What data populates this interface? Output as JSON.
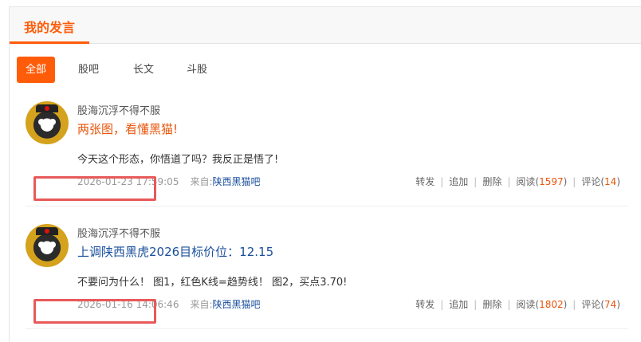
{
  "header": {
    "title": "我的发言"
  },
  "tabs": [
    {
      "label": "全部",
      "active": true
    },
    {
      "label": "股吧"
    },
    {
      "label": "长文"
    },
    {
      "label": "斗股"
    }
  ],
  "posts": [
    {
      "author": "股海沉浮不得不服",
      "title": "两张图，看懂黑猫!",
      "content": "今天这个形态，你悟道了吗？我反正是悟了!",
      "date": "2026-01-23 17:59:05",
      "from_label": "来自:",
      "source": "陕西黑猫吧",
      "actions": {
        "forward": "转发",
        "add": "追加",
        "delete": "删除",
        "read_label": "阅读(",
        "read_count": "1597",
        "comment_label": "评论(",
        "comment_count": "14",
        "close": ")"
      }
    },
    {
      "author": "股海沉浮不得不服",
      "title": "上调陕西黑虎2026目标价位：12.15",
      "content": "不要问为什么！ 图1，红色K线=趋势线！ 图2，买点3.70!",
      "date": "2026-01-16 14:06:46",
      "from_label": "来自:",
      "source": "陕西黑猫吧",
      "actions": {
        "forward": "转发",
        "add": "追加",
        "delete": "删除",
        "read_label": "阅读(",
        "read_count": "1802",
        "comment_label": "评论(",
        "comment_count": "74",
        "close": ")"
      }
    }
  ],
  "colors": {
    "accent": "#ff5c0a",
    "highlight_box": "#e85a5a",
    "link_blue": "#1a4f9c"
  }
}
